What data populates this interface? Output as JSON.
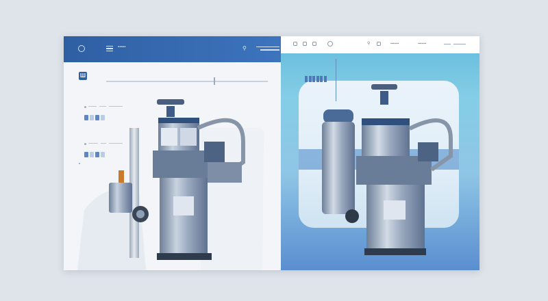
{
  "left_panel": {
    "header": {
      "title": "▪▪▪▪▪",
      "pin_icon": "pin-icon",
      "menu_icon": "menu-icon"
    },
    "toolbar": {
      "logo_text": "Ш"
    }
  },
  "right_panel": {
    "header": {
      "label_1": "▪▪▪▪▪▪▪",
      "label_2": "▪▪▪▪▪▪▪"
    }
  },
  "colors": {
    "header_blue": "#2f5fa3",
    "panel_light": "#f3f5f8",
    "right_bg_top": "#6cc0df",
    "right_bg_bottom": "#5a8ed0",
    "metal": "#8f9fb8"
  }
}
